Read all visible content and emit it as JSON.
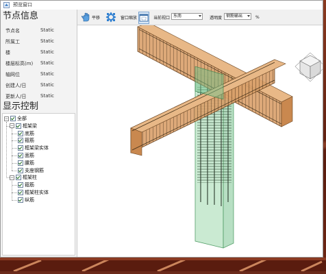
{
  "window": {
    "title": "预览窗口"
  },
  "node_info": {
    "title": "节点信息",
    "rows": [
      {
        "key": "节点名",
        "value": "Static"
      },
      {
        "key": "所属工",
        "value": "Static"
      },
      {
        "key": "楼",
        "value": "Static"
      },
      {
        "key": "楼层标高(m)",
        "value": "Static"
      },
      {
        "key": "轴网位",
        "value": "Static"
      },
      {
        "key": "创建人/日",
        "value": "Static"
      },
      {
        "key": "更新人/日",
        "value": "Static"
      }
    ]
  },
  "display_control": {
    "title": "显示控制",
    "tree": {
      "root": "全部",
      "groups": [
        {
          "label": "框架梁",
          "children": [
            "底筋",
            "箍筋",
            "框架梁实体",
            "面筋",
            "腰筋",
            "支座钢筋"
          ]
        },
        {
          "label": "框架柱",
          "children": [
            "箍筋",
            "框架柱实体",
            "纵筋"
          ]
        }
      ]
    }
  },
  "toolbar": {
    "pan_label": "平移",
    "fit_label": "窗口缩放",
    "view_label": "当前视口",
    "view_value": "东南",
    "opacity_label": "透明度",
    "opacity_value": "钢筋输出",
    "opacity_unit": "%"
  },
  "icons": [
    "app-icon",
    "pan-icon",
    "rotate-icon",
    "window-zoom-icon",
    "view-cube-icon"
  ],
  "colors": {
    "beam": "#c8925a",
    "column": "#6ec08a",
    "rebar_dark": "#3a3020"
  }
}
